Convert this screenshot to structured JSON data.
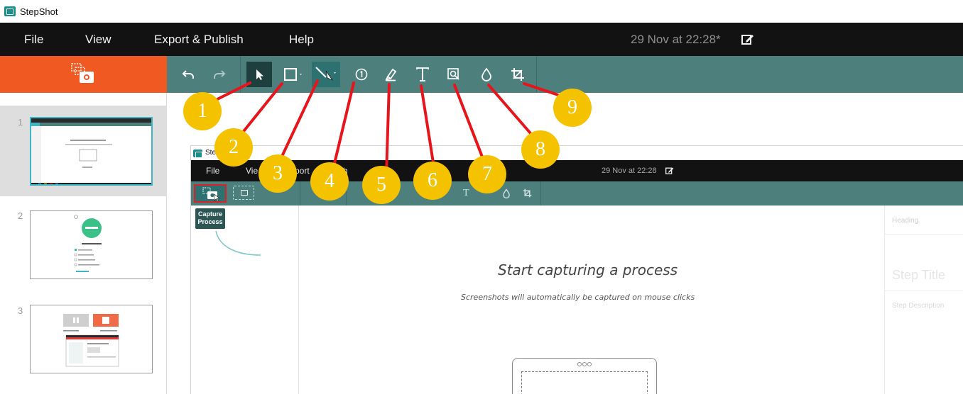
{
  "window": {
    "title": "StepShot"
  },
  "menu": {
    "items": [
      "File",
      "View",
      "Export & Publish",
      "Help"
    ],
    "date": "29 Nov at 22:28*"
  },
  "toolbar": {
    "tools": [
      "undo-icon",
      "redo-icon",
      "select-pointer-icon",
      "rectangle-icon",
      "line-arrow-icon",
      "numbered-marker-icon",
      "highlighter-icon",
      "text-icon",
      "magnifier-icon",
      "blur-drop-icon",
      "crop-icon"
    ]
  },
  "sidebar": {
    "slides": [
      {
        "number": "1"
      },
      {
        "number": "2"
      },
      {
        "number": "3"
      }
    ]
  },
  "inner": {
    "title": "Ste",
    "menu": [
      "File",
      "Vie",
      "port",
      "h"
    ],
    "date": "29 Nov at 22:28",
    "tooltip_line1": "Capture",
    "tooltip_line2": "Process",
    "start_title": "Start capturing a process",
    "start_sub": "Screenshots will automatically be captured on mouse clicks",
    "right_heading": "Heading",
    "right_step_title": "Step Title",
    "right_step_desc": "Step Description"
  },
  "annotations": {
    "badges": [
      "1",
      "2",
      "3",
      "4",
      "5",
      "6",
      "7",
      "8",
      "9"
    ],
    "color": "#f5c200",
    "line_color": "#e8141b"
  },
  "colors": {
    "menubar": "#121212",
    "toolbar": "#4d7f7d",
    "accent_orange": "#f05a22",
    "selected_thumb_border": "#3fb6c6"
  }
}
